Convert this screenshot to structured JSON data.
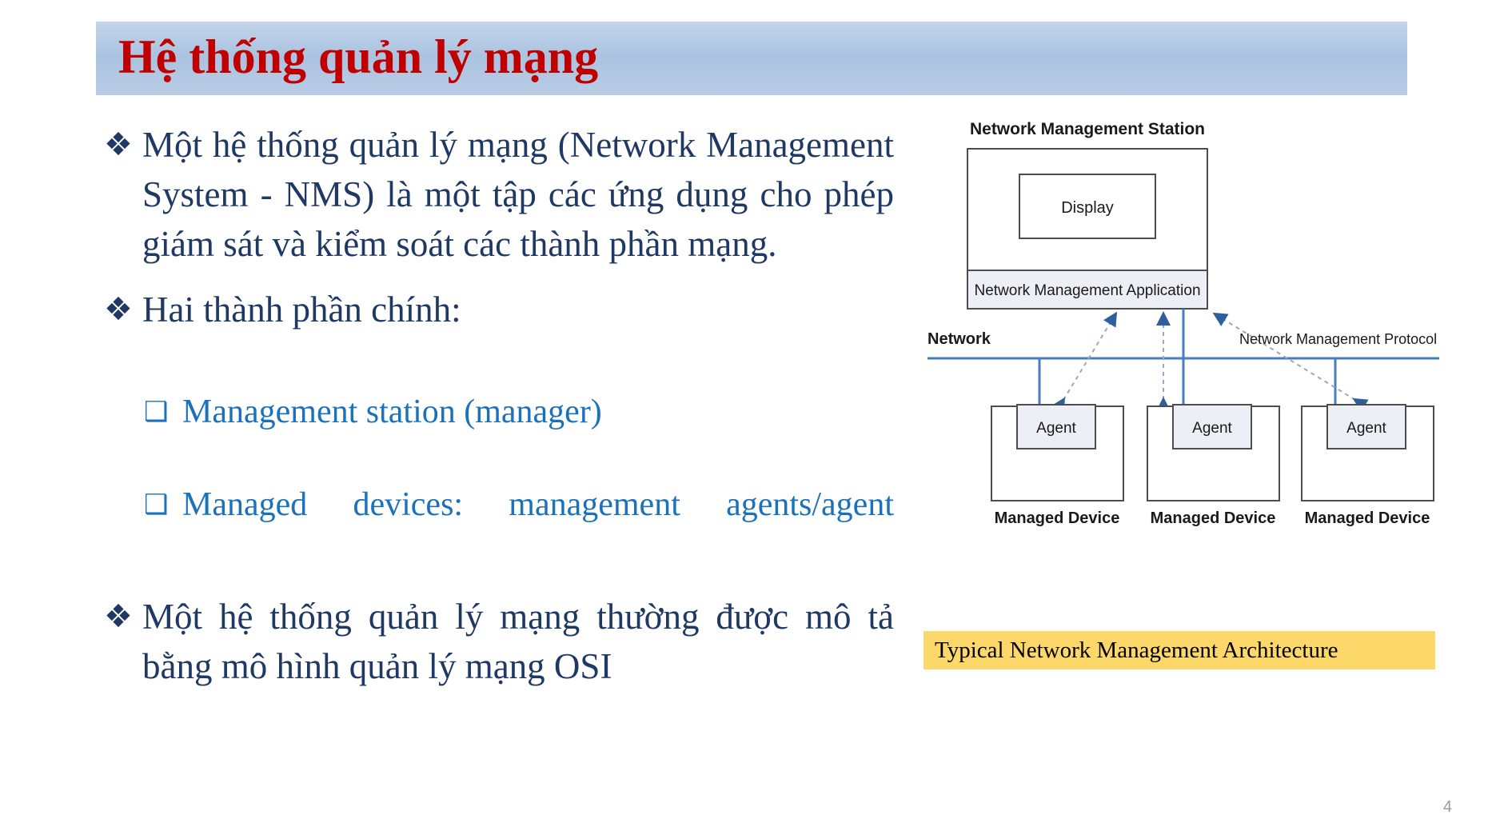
{
  "slide": {
    "title": "Hệ thống quản lý mạng",
    "page_number": "4",
    "title_color": "#c00000",
    "banner_color": "#aac3e0",
    "body_color": "#1f3864",
    "sub_color": "#1b72bb",
    "caption_bg": "#fcd769"
  },
  "bullets": [
    {
      "marker": "❖",
      "text": "Một hệ thống quản lý mạng (Network Management System - NMS) là một tập các ứng dụng cho phép giám sát và kiểm soát các thành phần mạng."
    },
    {
      "marker": "❖",
      "text": "Hai thành phần chính:"
    },
    {
      "marker": "❖",
      "text": "Một hệ thống quản lý mạng thường được mô tả bằng mô hình quản lý mạng OSI"
    }
  ],
  "sub_bullets": [
    {
      "marker": "❑",
      "text": "Management station (manager)"
    },
    {
      "marker": "❑",
      "text": "Managed devices: management agents/agent"
    }
  ],
  "diagram": {
    "station_title": "Network Management Station",
    "display_label": "Display",
    "application_label": "Network Management Application",
    "network_label": "Network",
    "protocol_label": "Network Management Protocol",
    "agents": [
      {
        "agent_label": "Agent",
        "device_label": "Managed Device"
      },
      {
        "agent_label": "Agent",
        "device_label": "Managed Device"
      },
      {
        "agent_label": "Agent",
        "device_label": "Managed Device"
      }
    ],
    "line_color": "#4a7ebb",
    "box_fill": "#eceff5",
    "box_stroke": "#4d4d4d"
  },
  "caption": {
    "text": "Typical Network Management Architecture"
  }
}
